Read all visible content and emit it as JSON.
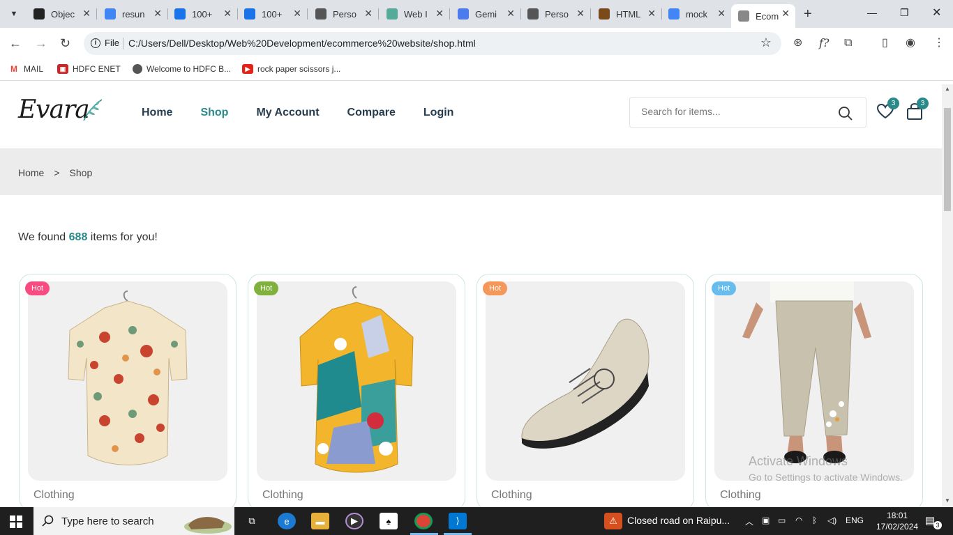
{
  "browser": {
    "tabs": [
      {
        "title": "Objec",
        "icon": "notion-icon",
        "color": "#222"
      },
      {
        "title": "resun",
        "icon": "google-icon",
        "color": "#4285F4"
      },
      {
        "title": "100+",
        "icon": "t-app-icon",
        "color": "#1a73e8"
      },
      {
        "title": "100+",
        "icon": "t-app-icon",
        "color": "#1a73e8"
      },
      {
        "title": "Perso",
        "icon": "globe-icon",
        "color": "#555"
      },
      {
        "title": "Web I",
        "icon": "chatgpt-icon",
        "color": "#5a9"
      },
      {
        "title": "Gemi",
        "icon": "gemini-icon",
        "color": "#4b7bec"
      },
      {
        "title": "Perso",
        "icon": "globe-icon",
        "color": "#555"
      },
      {
        "title": "HTML",
        "icon": "book-icon",
        "color": "#7a4a1a"
      },
      {
        "title": "mock",
        "icon": "google-icon",
        "color": "#4285F4"
      },
      {
        "title": "Ecom",
        "icon": "evara-icon",
        "color": "#888"
      }
    ],
    "url_label": "File",
    "url": "C:/Users/Dell/Desktop/Web%20Development/ecommerce%20website/shop.html",
    "bookmarks": [
      {
        "label": "MAIL",
        "icon": "gmail-icon"
      },
      {
        "label": "HDFC ENET",
        "icon": "hdfc-icon"
      },
      {
        "label": "Welcome to HDFC B...",
        "icon": "globe-icon"
      },
      {
        "label": "rock paper scissors j...",
        "icon": "youtube-icon"
      }
    ]
  },
  "site": {
    "logo": "Evara",
    "nav": [
      {
        "label": "Home",
        "active": false
      },
      {
        "label": "Shop",
        "active": true
      },
      {
        "label": "My Account",
        "active": false
      },
      {
        "label": "Compare",
        "active": false
      },
      {
        "label": "Login",
        "active": false
      }
    ],
    "search_placeholder": "Search for items...",
    "wishlist_count": "3",
    "cart_count": "3",
    "breadcrumb": [
      "Home",
      ">",
      "Shop"
    ],
    "found_prefix": "We found ",
    "found_count": "688",
    "found_suffix": " items for you!",
    "products": [
      {
        "badge": "Hot",
        "badge_color": "#f74b81",
        "category": "Clothing",
        "image": "mushroom-shirt"
      },
      {
        "badge": "Hot",
        "badge_color": "#81b13d",
        "category": "Clothing",
        "image": "floral-shirt"
      },
      {
        "badge": "Hot",
        "badge_color": "#f59758",
        "category": "Clothing",
        "image": "sneaker"
      },
      {
        "badge": "Hot",
        "badge_color": "#67bcee",
        "category": "Clothing",
        "image": "linen-pants"
      }
    ],
    "watermark_title": "Activate Windows",
    "watermark_sub": "Go to Settings to activate Windows."
  },
  "taskbar": {
    "search_placeholder": "Type here to search",
    "news": "Closed road on Raipu...",
    "language": "ENG",
    "time": "18:01",
    "date": "17/02/2024",
    "notifications": "3"
  }
}
